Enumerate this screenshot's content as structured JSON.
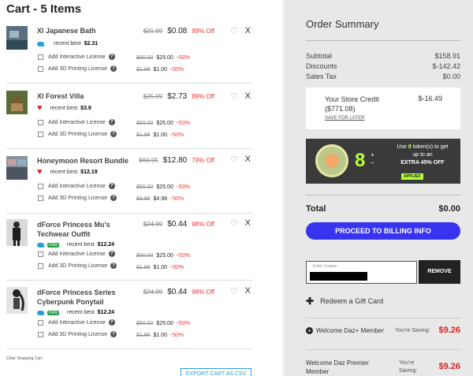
{
  "cart": {
    "title": "Cart - 5 Items",
    "items": [
      {
        "name": "Xl Japanese Bath",
        "old_price": "$21.99",
        "price": "$0.08",
        "discount": "99% Off",
        "recent_label": "recent best",
        "recent_value": "$2.31",
        "badge": "bird",
        "new": ""
      },
      {
        "name": "Xl Forest Villa",
        "old_price": "$25.99",
        "price": "$2.73",
        "discount": "89% Off",
        "recent_label": "recent best",
        "recent_value": "$3.9",
        "badge": "heart",
        "new": ""
      },
      {
        "name": "Honeymoon Resort Bundle",
        "old_price": "$60.95",
        "price": "$12.80",
        "discount": "79% Off",
        "recent_label": "recent best",
        "recent_value": "$12.19",
        "badge": "heart",
        "new": ""
      },
      {
        "name_line1": "dForce Princess Mu's",
        "name_line2": "Techwear Outfit",
        "old_price": "$24.99",
        "price": "$0.44",
        "discount": "98% Off",
        "recent_label": "recent best",
        "recent_value": "$12.24",
        "badge": "bird",
        "new": "new"
      },
      {
        "name_line1": "dForce Princess Series",
        "name_line2": "Cyberpunk Ponytail",
        "old_price": "$24.99",
        "price": "$0.44",
        "discount": "98% Off",
        "recent_label": "recent best",
        "recent_value": "$12.24",
        "badge": "bird",
        "new": "new"
      }
    ],
    "addons": {
      "interactive_label": "Add Interactive License",
      "printing_label": "Add 3D Printing License",
      "interactive_old": "$50.00",
      "interactive_price": "$25.00",
      "interactive_disc": "−50%",
      "printing_old": "$1.99",
      "printing_price": "$1.00",
      "printing_disc": "−50%",
      "printing_old_3": "$9.95",
      "printing_price_3": "$4.98"
    },
    "clear_label": "Clear Shopping Cart",
    "export_label": "EXPORT CART AS CSV"
  },
  "summary": {
    "title": "Order Summary",
    "subtotal_label": "Subtotal",
    "subtotal": "$158.91",
    "discounts_label": "Discounts",
    "discounts": "$-142.42",
    "tax_label": "Sales Tax",
    "tax": "$0.00",
    "credit_label": "Your Store Credit",
    "credit_amount": "($771.08)",
    "credit_applied": "$-16.49",
    "save_later": "SAVE FOR LATER",
    "token_count": "8",
    "token_line1": "Use",
    "token_line1b": "token(s) to get",
    "token_line2": "up to an",
    "token_line3": "EXTRA 45% OFF",
    "applied": "APPLIED",
    "total_label": "Total",
    "total": "$0.00",
    "proceed": "PROCEED TO BILLING INFO",
    "coupon_placeholder": "Enter Coupon",
    "remove": "REMOVE",
    "gift": "Redeem a Gift Card",
    "member1": "Welcome Daz+ Member",
    "member1_saving_label": "You're Saving:",
    "member1_saving": "$9.26",
    "member2_l1": "Welcome Daz Premier",
    "member2_l2": "Member",
    "member2_saving_l1": "You're",
    "member2_saving_l2": "Saving:",
    "member2_saving": "$9.26"
  },
  "colors": {
    "accent": "#3734f0",
    "discount_red": "#e53935",
    "token_green": "#b6ff3b"
  }
}
